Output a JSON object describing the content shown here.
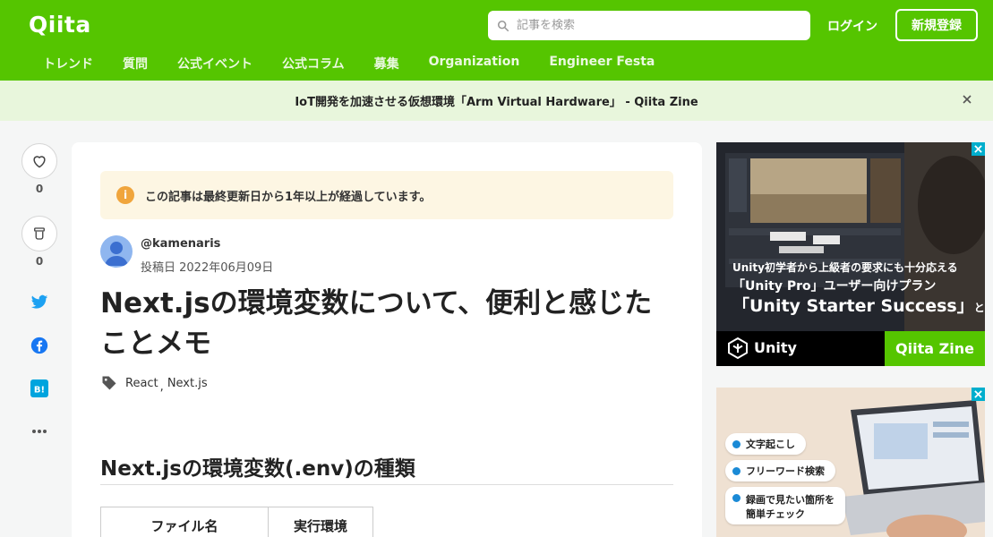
{
  "header": {
    "logo": "Qiita",
    "search_placeholder": "記事を検索",
    "login": "ログイン",
    "signup": "新規登録",
    "nav": [
      "トレンド",
      "質問",
      "公式イベント",
      "公式コラム",
      "募集",
      "Organization",
      "Engineer Festa"
    ]
  },
  "banner": {
    "text": "IoT開発を加速させる仮想環境「Arm Virtual Hardware」 - Qiita Zine"
  },
  "actions": {
    "like_count": "0",
    "stock_count": "0"
  },
  "article": {
    "notice": "この記事は最終更新日から1年以上が経過しています。",
    "author": "@kamenaris",
    "posted": "投稿日 2022年06月09日",
    "title_line1": "Next.jsの環境変数について、便利と感じた",
    "title_line2": "ことメモ",
    "tags": [
      "React",
      "Next.js"
    ],
    "h2": "Next.jsの環境変数(.env)の種類",
    "table_headers": [
      "ファイル名",
      "実行環境"
    ]
  },
  "ads": {
    "ad1": {
      "line1": "Unity初学者から上級者の要求にも十分応える",
      "line2": "「Unity Pro」ユーザー向けプラン",
      "line3": "「Unity Starter Success」",
      "line3_suffix": "とは",
      "brand": "Unity",
      "zine": "Qiita Zine"
    },
    "ad2": {
      "pills": [
        "文字起こし",
        "フリーワード検索",
        "録画で見たい箇所を",
        "簡単チェック"
      ]
    }
  },
  "colors": {
    "brand": "#55c500",
    "banner_bg": "#e8f6dc",
    "notice_bg": "#fdf6e3",
    "twitter": "#1da1f2",
    "facebook": "#1877f2",
    "hatena": "#00a4de"
  }
}
